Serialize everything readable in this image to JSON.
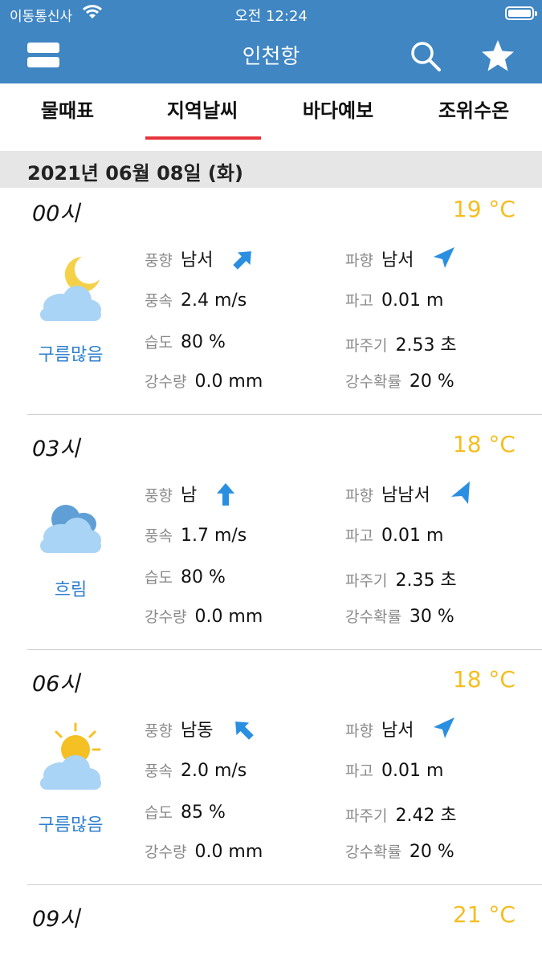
{
  "status_bar": {
    "carrier": "이동통신사",
    "time": "오전 12:24"
  },
  "header": {
    "title": "인천항"
  },
  "tabs": [
    "물때표",
    "지역날씨",
    "바다예보",
    "조위수온"
  ],
  "active_tab": "지역날씨",
  "date_label": "2021년 06월 08일 (화)",
  "labels": {
    "wind_dir": "풍향",
    "wind_speed": "풍속",
    "humidity": "습도",
    "precip": "강수량",
    "wave_dir": "파향",
    "wave_height": "파고",
    "wave_period": "파주기",
    "precip_prob": "강수확률"
  },
  "forecasts": [
    {
      "hour": "00시",
      "temp": "19 °C",
      "condition": "구름많음",
      "icon": "cloud-moon-icon",
      "wind_dir": "남서",
      "wind_speed": "2.4 m/s",
      "humidity": "80 %",
      "precip": "0.0 mm",
      "wave_dir": "남서",
      "wave_height": "0.01 m",
      "wave_period": "2.53 초",
      "precip_prob": "20 %"
    },
    {
      "hour": "03시",
      "temp": "18 °C",
      "condition": "흐림",
      "icon": "cloudy-icon",
      "wind_dir": "남",
      "wind_speed": "1.7 m/s",
      "humidity": "80 %",
      "precip": "0.0 mm",
      "wave_dir": "남남서",
      "wave_height": "0.01 m",
      "wave_period": "2.35 초",
      "precip_prob": "30 %"
    },
    {
      "hour": "06시",
      "temp": "18 °C",
      "condition": "구름많음",
      "icon": "cloud-sun-icon",
      "wind_dir": "남동",
      "wind_speed": "2.0 m/s",
      "humidity": "85 %",
      "precip": "0.0 mm",
      "wave_dir": "남서",
      "wave_height": "0.01 m",
      "wave_period": "2.42 초",
      "precip_prob": "20 %"
    },
    {
      "hour": "09시",
      "temp": "21 °C"
    }
  ],
  "colors": {
    "header_bg": "#3f86c3",
    "tab_indicator": "#e8343d",
    "temp": "#f5bd20",
    "condition": "#2d7fcf",
    "arrow": "#2a8fe0"
  }
}
